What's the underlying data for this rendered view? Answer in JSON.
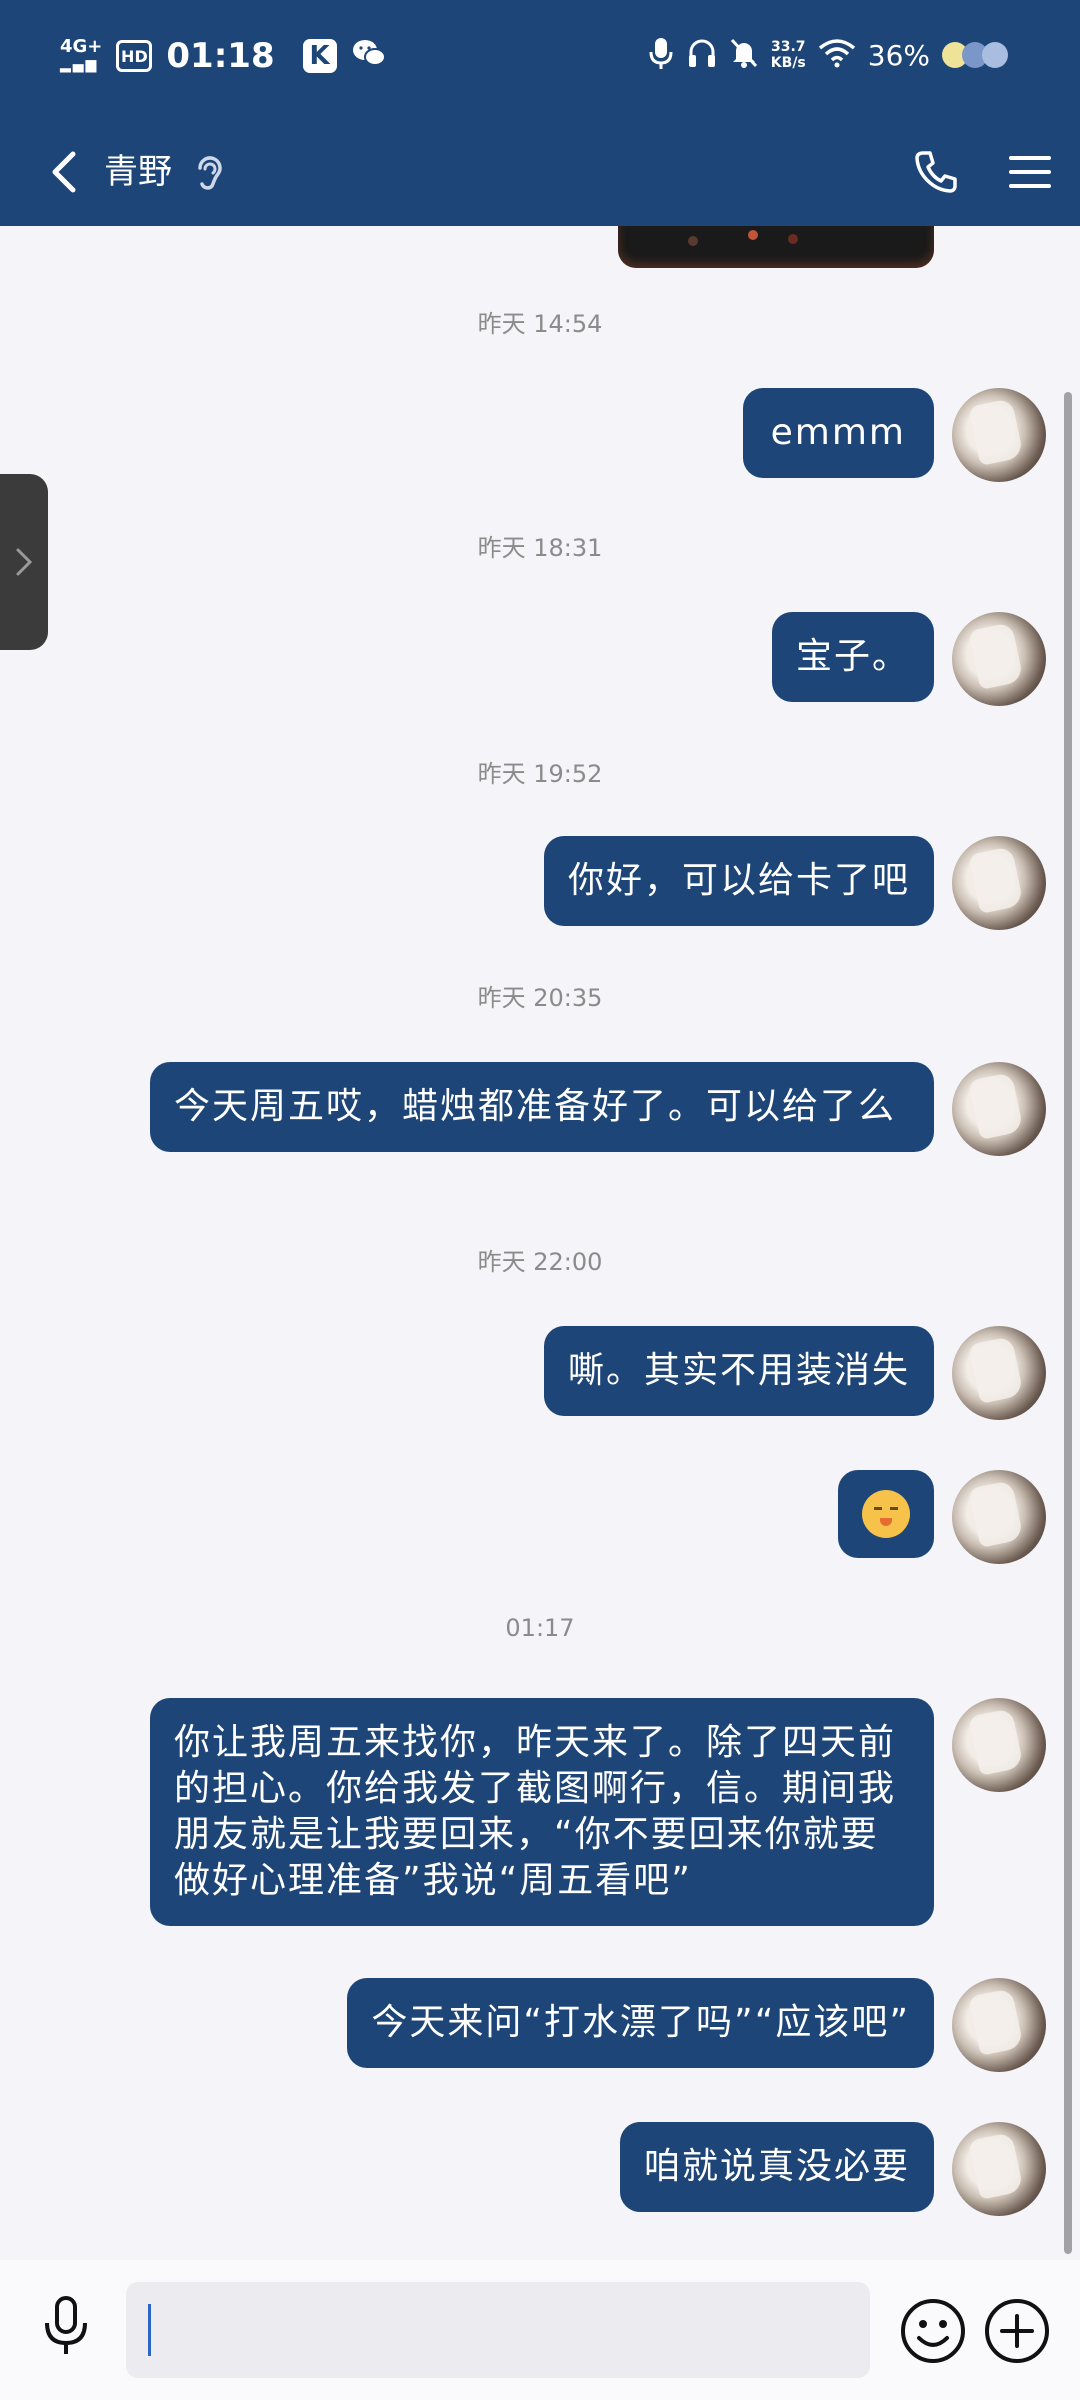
{
  "status_bar": {
    "network": "4G+",
    "hd": "HD",
    "time": "01:18",
    "app_k": "K",
    "speed_value": "33.7",
    "speed_unit": "KB/s",
    "battery": "36%"
  },
  "header": {
    "title": "青野"
  },
  "timestamps": [
    "昨天 14:54",
    "昨天 18:31",
    "昨天 19:52",
    "昨天 20:35",
    "昨天 22:00",
    "01:17"
  ],
  "messages": [
    "emmm",
    "宝子。",
    "你好，可以给卡了吧",
    "今天周五哎，蜡烛都准备好了。可以给了么",
    "嘶。其实不用装消失",
    "",
    "你让我周五来找你，昨天来了。除了四天前的担心。你给我发了截图啊行，信。期间我朋友就是让我要回来，“你不要回来你就要做好心理准备”我说“周五看吧”",
    "今天来问“打水漂了吗”“应该吧”",
    "咱就说真没必要"
  ],
  "emoji_message_icon": "confounded-face-emoji",
  "input": {
    "value": "",
    "placeholder": ""
  },
  "colors": {
    "brand": "#1d4577",
    "background": "#f4f4f9",
    "timestamp": "#8b8b8b"
  }
}
